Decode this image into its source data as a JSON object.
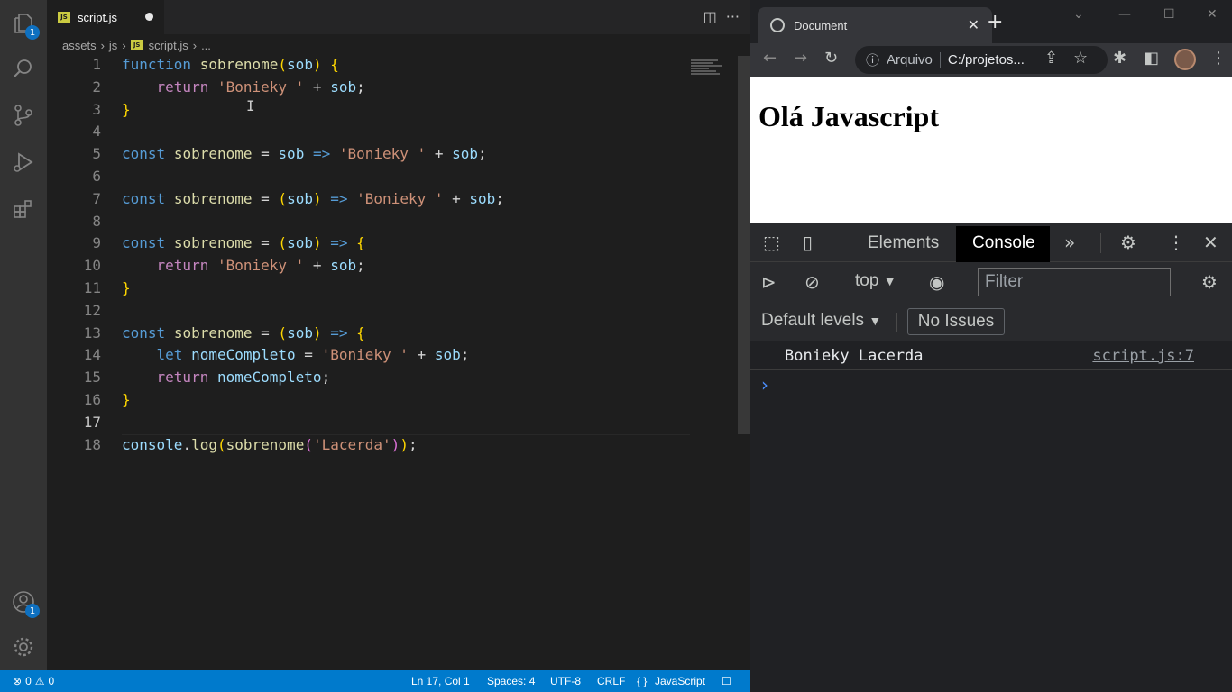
{
  "colors": {
    "accent": "#007acc",
    "statusbar": "#007acc",
    "badge": "#0e70c0"
  },
  "vscode": {
    "activity_badges": {
      "explorer": "1",
      "accounts": "1"
    },
    "tab": {
      "filename": "script.js",
      "badge": "JS"
    },
    "breadcrumb": [
      "assets",
      "js",
      "script.js",
      "..."
    ],
    "line_numbers": [
      "1",
      "2",
      "3",
      "4",
      "5",
      "6",
      "7",
      "8",
      "9",
      "10",
      "11",
      "12",
      "13",
      "14",
      "15",
      "16",
      "17",
      "18"
    ],
    "active_line": "17",
    "code_lines": [
      [
        {
          "t": "function",
          "c": "kw"
        },
        {
          "t": " ",
          "c": "op"
        },
        {
          "t": "sobrenome",
          "c": "fn"
        },
        {
          "t": "(",
          "c": "br1"
        },
        {
          "t": "sob",
          "c": "var"
        },
        {
          "t": ")",
          "c": "br1"
        },
        {
          "t": " ",
          "c": "op"
        },
        {
          "t": "{",
          "c": "br1"
        }
      ],
      [
        {
          "t": "    ",
          "c": "op"
        },
        {
          "t": "return",
          "c": "kw2"
        },
        {
          "t": " ",
          "c": "op"
        },
        {
          "t": "'Bonieky '",
          "c": "str"
        },
        {
          "t": " + ",
          "c": "op"
        },
        {
          "t": "sob",
          "c": "var"
        },
        {
          "t": ";",
          "c": "op"
        }
      ],
      [
        {
          "t": "}",
          "c": "br1"
        }
      ],
      [],
      [
        {
          "t": "const",
          "c": "kw"
        },
        {
          "t": " ",
          "c": "op"
        },
        {
          "t": "sobrenome",
          "c": "fn"
        },
        {
          "t": " = ",
          "c": "op"
        },
        {
          "t": "sob",
          "c": "var"
        },
        {
          "t": " ",
          "c": "op"
        },
        {
          "t": "=>",
          "c": "kw"
        },
        {
          "t": " ",
          "c": "op"
        },
        {
          "t": "'Bonieky '",
          "c": "str"
        },
        {
          "t": " + ",
          "c": "op"
        },
        {
          "t": "sob",
          "c": "var"
        },
        {
          "t": ";",
          "c": "op"
        }
      ],
      [],
      [
        {
          "t": "const",
          "c": "kw"
        },
        {
          "t": " ",
          "c": "op"
        },
        {
          "t": "sobrenome",
          "c": "fn"
        },
        {
          "t": " = ",
          "c": "op"
        },
        {
          "t": "(",
          "c": "br1"
        },
        {
          "t": "sob",
          "c": "var"
        },
        {
          "t": ")",
          "c": "br1"
        },
        {
          "t": " ",
          "c": "op"
        },
        {
          "t": "=>",
          "c": "kw"
        },
        {
          "t": " ",
          "c": "op"
        },
        {
          "t": "'Bonieky '",
          "c": "str"
        },
        {
          "t": " + ",
          "c": "op"
        },
        {
          "t": "sob",
          "c": "var"
        },
        {
          "t": ";",
          "c": "op"
        }
      ],
      [],
      [
        {
          "t": "const",
          "c": "kw"
        },
        {
          "t": " ",
          "c": "op"
        },
        {
          "t": "sobrenome",
          "c": "fn"
        },
        {
          "t": " = ",
          "c": "op"
        },
        {
          "t": "(",
          "c": "br1"
        },
        {
          "t": "sob",
          "c": "var"
        },
        {
          "t": ")",
          "c": "br1"
        },
        {
          "t": " ",
          "c": "op"
        },
        {
          "t": "=>",
          "c": "kw"
        },
        {
          "t": " ",
          "c": "op"
        },
        {
          "t": "{",
          "c": "br1"
        }
      ],
      [
        {
          "t": "    ",
          "c": "op"
        },
        {
          "t": "return",
          "c": "kw2"
        },
        {
          "t": " ",
          "c": "op"
        },
        {
          "t": "'Bonieky '",
          "c": "str"
        },
        {
          "t": " + ",
          "c": "op"
        },
        {
          "t": "sob",
          "c": "var"
        },
        {
          "t": ";",
          "c": "op"
        }
      ],
      [
        {
          "t": "}",
          "c": "br1"
        }
      ],
      [],
      [
        {
          "t": "const",
          "c": "kw"
        },
        {
          "t": " ",
          "c": "op"
        },
        {
          "t": "sobrenome",
          "c": "fn"
        },
        {
          "t": " = ",
          "c": "op"
        },
        {
          "t": "(",
          "c": "br1"
        },
        {
          "t": "sob",
          "c": "var"
        },
        {
          "t": ")",
          "c": "br1"
        },
        {
          "t": " ",
          "c": "op"
        },
        {
          "t": "=>",
          "c": "kw"
        },
        {
          "t": " ",
          "c": "op"
        },
        {
          "t": "{",
          "c": "br1"
        }
      ],
      [
        {
          "t": "    ",
          "c": "op"
        },
        {
          "t": "let",
          "c": "kw"
        },
        {
          "t": " ",
          "c": "op"
        },
        {
          "t": "nomeCompleto",
          "c": "var"
        },
        {
          "t": " = ",
          "c": "op"
        },
        {
          "t": "'Bonieky '",
          "c": "str"
        },
        {
          "t": " + ",
          "c": "op"
        },
        {
          "t": "sob",
          "c": "var"
        },
        {
          "t": ";",
          "c": "op"
        }
      ],
      [
        {
          "t": "    ",
          "c": "op"
        },
        {
          "t": "return",
          "c": "kw2"
        },
        {
          "t": " ",
          "c": "op"
        },
        {
          "t": "nomeCompleto",
          "c": "var"
        },
        {
          "t": ";",
          "c": "op"
        }
      ],
      [
        {
          "t": "}",
          "c": "br1"
        }
      ],
      [],
      [
        {
          "t": "console",
          "c": "var"
        },
        {
          "t": ".",
          "c": "op"
        },
        {
          "t": "log",
          "c": "fn"
        },
        {
          "t": "(",
          "c": "br1"
        },
        {
          "t": "sobrenome",
          "c": "fn"
        },
        {
          "t": "(",
          "c": "br2"
        },
        {
          "t": "'Lacerda'",
          "c": "str"
        },
        {
          "t": ")",
          "c": "br2"
        },
        {
          "t": ")",
          "c": "br1"
        },
        {
          "t": ";",
          "c": "op"
        }
      ]
    ],
    "status": {
      "errors": "0",
      "warnings": "0",
      "position": "Ln 17, Col 1",
      "spaces": "Spaces: 4",
      "encoding": "UTF-8",
      "eol": "CRLF",
      "language": "JavaScript",
      "language_icon": "{ }"
    }
  },
  "chrome": {
    "tab_title": "Document",
    "omnibox_scheme": "Arquivo",
    "omnibox_url": "C:/projetos...",
    "page_heading": "Olá Javascript",
    "devtools": {
      "tabs": [
        "Elements",
        "Console"
      ],
      "active_tab": "Console",
      "context": "top",
      "filter_placeholder": "Filter",
      "levels": "Default levels",
      "issues": "No Issues",
      "log_message": "Bonieky Lacerda",
      "log_source": "script.js:7"
    }
  }
}
